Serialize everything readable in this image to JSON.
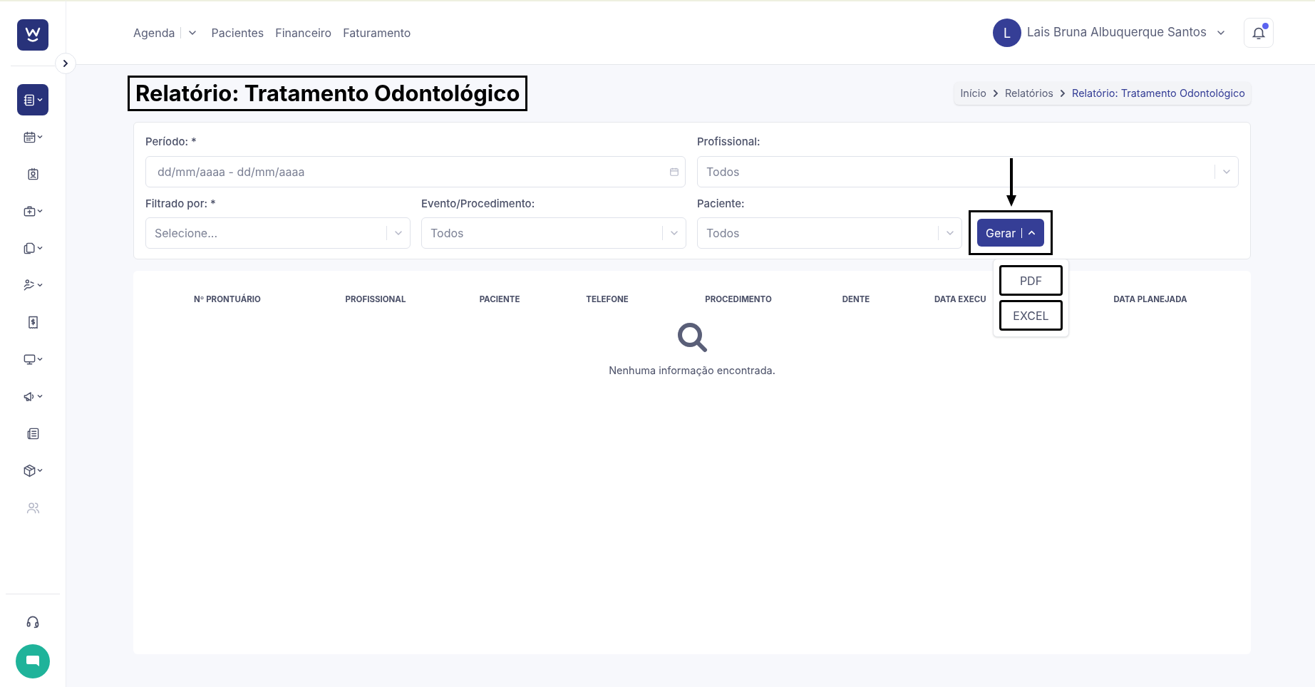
{
  "nav": {
    "items": [
      {
        "label": "Agenda",
        "has_menu": true
      },
      {
        "label": "Pacientes",
        "has_menu": false
      },
      {
        "label": "Financeiro",
        "has_menu": false
      },
      {
        "label": "Faturamento",
        "has_menu": false
      }
    ]
  },
  "user": {
    "initial": "L",
    "name": "Lais Bruna Albuquerque Santos",
    "has_notification": true
  },
  "sidebar": {
    "items": [
      {
        "kind": "notebook",
        "selected": true,
        "has_menu": true
      },
      {
        "kind": "calendar",
        "selected": false,
        "has_menu": true
      },
      {
        "kind": "badge",
        "selected": false,
        "has_menu": false
      },
      {
        "kind": "medkit",
        "selected": false,
        "has_menu": true
      },
      {
        "kind": "files",
        "selected": false,
        "has_menu": true
      },
      {
        "kind": "hand",
        "selected": false,
        "has_menu": true
      },
      {
        "kind": "receipt",
        "selected": false,
        "has_menu": false
      },
      {
        "kind": "monitor",
        "selected": false,
        "has_menu": true
      },
      {
        "kind": "megaphone",
        "selected": false,
        "has_menu": true
      },
      {
        "kind": "newspaper",
        "selected": false,
        "has_menu": false
      },
      {
        "kind": "box",
        "selected": false,
        "has_menu": true
      },
      {
        "kind": "users",
        "selected": false,
        "disabled": true,
        "has_menu": false
      }
    ]
  },
  "page": {
    "title": "Relatório: Tratamento Odontológico",
    "highlighted": true
  },
  "breadcrumb": [
    {
      "label": "Início",
      "current": false
    },
    {
      "label": "Relatórios",
      "current": false
    },
    {
      "label": "Relatório: Tratamento Odontológico",
      "current": true
    }
  ],
  "filters": [
    {
      "label": "Período: *",
      "placeholder": "dd/mm/aaaa - dd/mm/aaaa",
      "kind": "date"
    },
    {
      "label": "Profissional:",
      "placeholder": "Todos",
      "kind": "select"
    },
    {
      "label": "Filtrado por: *",
      "placeholder": "Selecione...",
      "kind": "select"
    },
    {
      "label": "Evento/Procedimento:",
      "placeholder": "Todos",
      "kind": "select"
    },
    {
      "label": "Paciente:",
      "placeholder": "Todos",
      "kind": "select"
    }
  ],
  "generate_button": {
    "label": "Gerar",
    "expanded": true,
    "highlighted": true,
    "arrow": true
  },
  "export_menu": [
    {
      "label": "PDF",
      "highlighted": true
    },
    {
      "label": "EXCEL",
      "highlighted": true
    }
  ],
  "table": {
    "columns": [
      "Nº PRONTUÁRIO",
      "PROFISSIONAL",
      "PACIENTE",
      "TELEFONE",
      "PROCEDIMENTO",
      "DENTE",
      "DATA EXECU",
      "DATA PLANEJADA"
    ],
    "empty_message": "Nenhuma informação encontrada."
  }
}
